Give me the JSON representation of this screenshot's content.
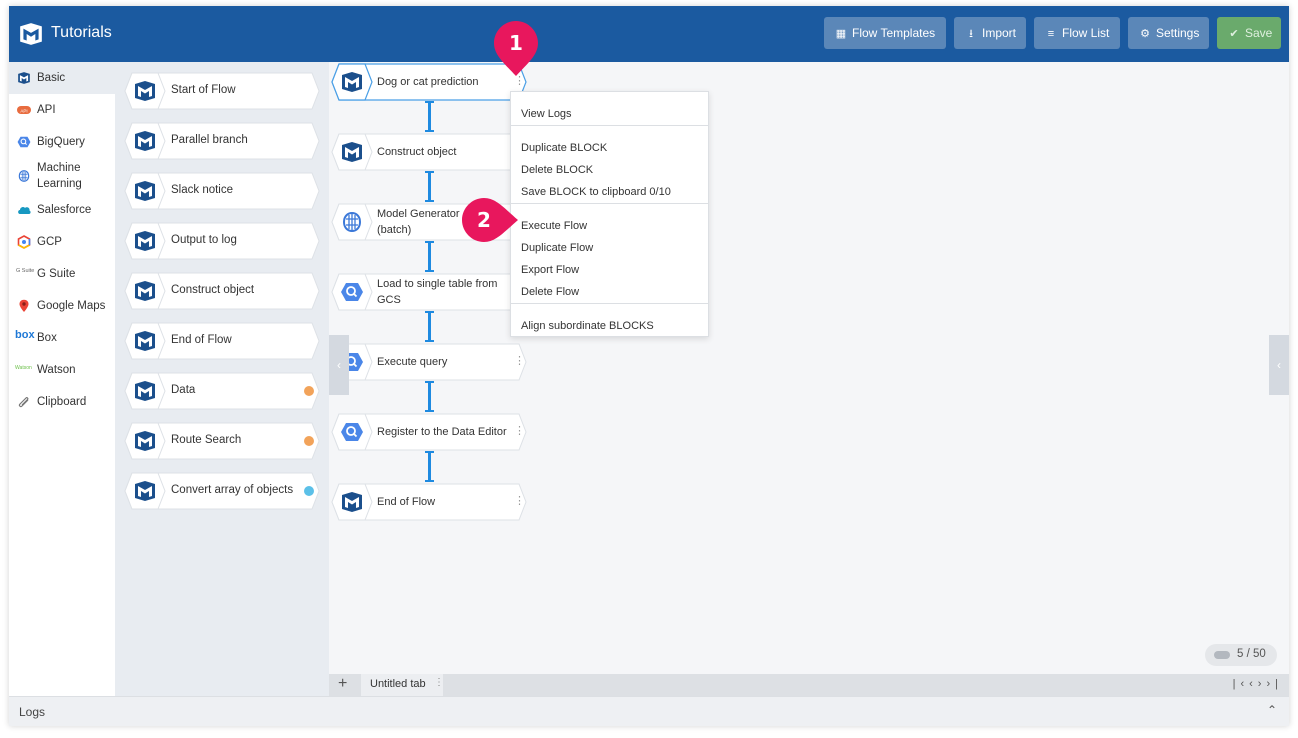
{
  "app": {
    "title": "Tutorials"
  },
  "header": {
    "buttons": {
      "flow_templates": "Flow Templates",
      "import": "Import",
      "flow_list": "Flow List",
      "settings": "Settings",
      "save": "Save"
    }
  },
  "categories": [
    {
      "label": "Basic",
      "icon": "mapping-logo-icon",
      "active": true
    },
    {
      "label": "API",
      "icon": "api-icon"
    },
    {
      "label": "BigQuery",
      "icon": "bigquery-icon"
    },
    {
      "label": "Machine Learning",
      "icon": "machine-learning-icon"
    },
    {
      "label": "Salesforce",
      "icon": "salesforce-cloud-icon"
    },
    {
      "label": "GCP",
      "icon": "gcp-icon"
    },
    {
      "label": "G Suite",
      "icon": "g-suite-icon",
      "icon_text": "G Suite"
    },
    {
      "label": "Google Maps",
      "icon": "map-pin-icon"
    },
    {
      "label": "Box",
      "icon": "box-icon",
      "icon_text": "box"
    },
    {
      "label": "Watson",
      "icon": "watson-icon",
      "icon_text": "Watson"
    },
    {
      "label": "Clipboard",
      "icon": "paperclip-icon"
    }
  ],
  "palette": {
    "blocks": [
      {
        "label": "Start of Flow"
      },
      {
        "label": "Parallel branch"
      },
      {
        "label": "Slack notice"
      },
      {
        "label": "Output to log"
      },
      {
        "label": "Construct object"
      },
      {
        "label": "End of Flow"
      },
      {
        "label": "Data",
        "dot_color": "#f2a35a"
      },
      {
        "label": "Route Search",
        "dot_color": "#f2a35a"
      },
      {
        "label": "Convert array of objects",
        "dot_color": "#5bc0e8"
      }
    ]
  },
  "flow": {
    "blocks": [
      {
        "label": "Dog or cat prediction",
        "icon": "mapping-logo-icon",
        "selected": true
      },
      {
        "label": "Construct object",
        "icon": "mapping-logo-icon"
      },
      {
        "label": "Model Generator (batch)",
        "line1": "Model Generator",
        "line2": "(batch)",
        "icon": "machine-learning-icon"
      },
      {
        "label": "Load to single table from GCS",
        "line1": "Load to single table from",
        "line2": "GCS",
        "icon": "bigquery-icon"
      },
      {
        "label": "Execute query",
        "icon": "bigquery-icon"
      },
      {
        "label": "Register to the Data Editor",
        "icon": "bigquery-icon"
      },
      {
        "label": "End of Flow",
        "icon": "mapping-logo-icon"
      }
    ]
  },
  "context_menu": {
    "view_logs": "View Logs",
    "duplicate_block": "Duplicate BLOCK",
    "delete_block": "Delete BLOCK",
    "save_block_clipboard": "Save BLOCK to clipboard 0/10",
    "execute_flow": "Execute Flow",
    "duplicate_flow": "Duplicate Flow",
    "export_flow": "Export Flow",
    "delete_flow": "Delete Flow",
    "align_blocks": "Align subordinate BLOCKS"
  },
  "callouts": {
    "first": "1",
    "second": "2",
    "color": "#e8175d"
  },
  "counter": {
    "text": "5 / 50"
  },
  "tabs": {
    "add": "+",
    "items": [
      {
        "label": "Untitled tab"
      }
    ]
  },
  "logs": {
    "label": "Logs"
  },
  "colors": {
    "header": "#1b5aa0",
    "connector": "#1e8ae0",
    "save": "#6aaa6c"
  }
}
